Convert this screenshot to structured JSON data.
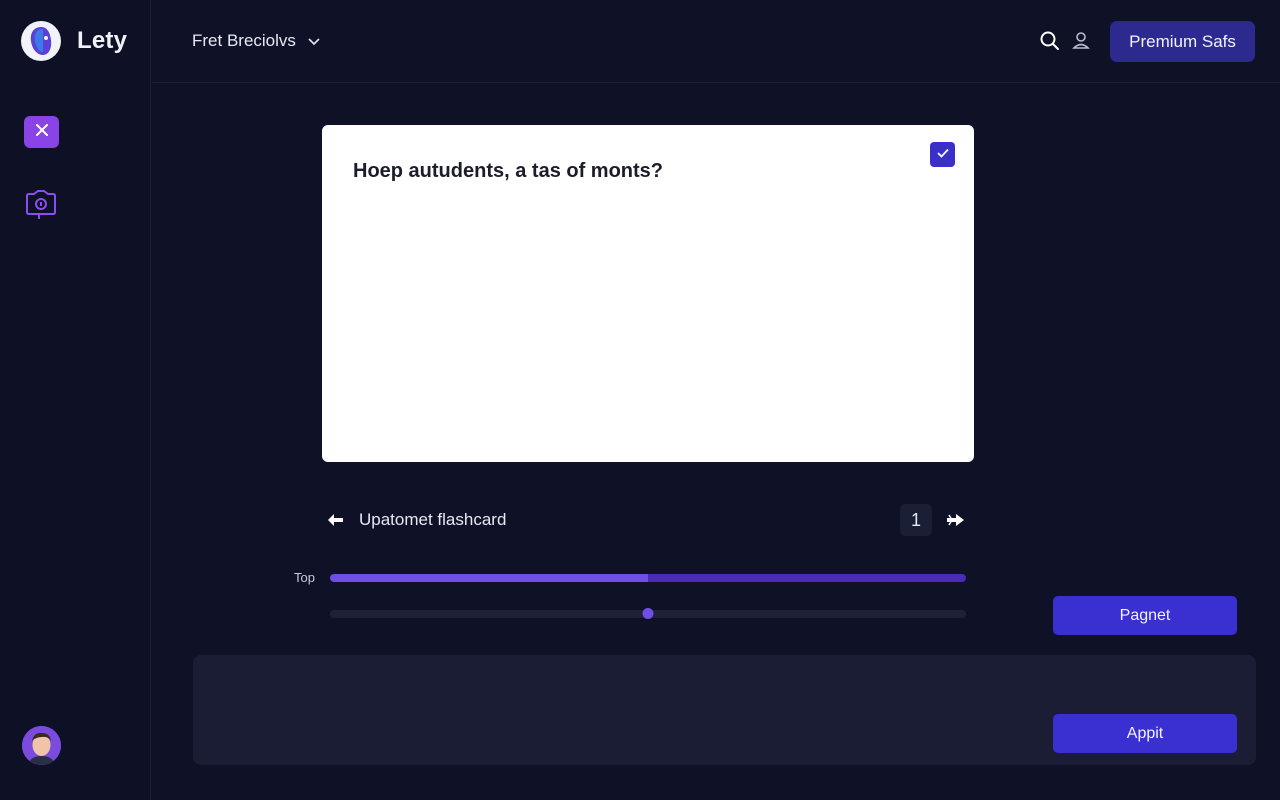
{
  "app": {
    "name": "Lety"
  },
  "header": {
    "deck_selector": "Fret Breciolvs",
    "premium_label": "Premium Safs"
  },
  "flashcard": {
    "question": "Hoep autudents, a tas of monts?",
    "checked": true
  },
  "navigation": {
    "label": "Upatomet flashcard",
    "page": "1"
  },
  "progress": {
    "label": "Top",
    "value_fraction": 0.5
  },
  "slider": {
    "value_fraction": 0.5
  },
  "buttons": {
    "pagnet": "Pagnet",
    "appit": "Appit"
  },
  "icons": {
    "sidebar_close": "close-icon",
    "sidebar_camera": "camera-icon",
    "search": "search-icon",
    "user": "user-icon",
    "check": "check-icon",
    "prev": "arrow-left-icon",
    "next": "arrow-right-icon",
    "dropdown": "chevron-down-icon"
  },
  "colors": {
    "background": "#0f1226",
    "accent": "#3a2fd0",
    "accent_light": "#6f4ee8",
    "sidebar_button": "#8a43e6"
  }
}
